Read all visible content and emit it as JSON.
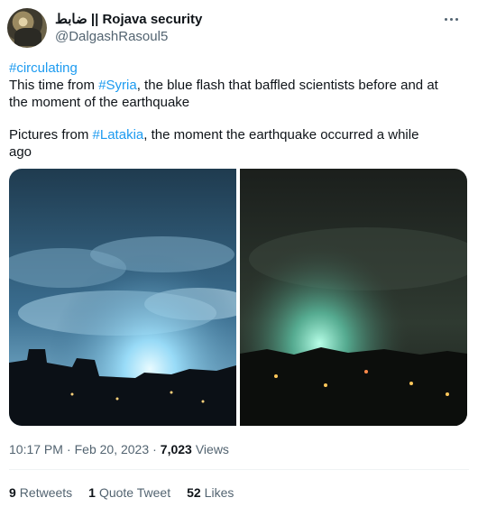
{
  "author": {
    "display_name": "ضابط || Rojava security",
    "handle": "@DalgashRasoul5"
  },
  "tweet": {
    "line1_hashtag": "#circulating",
    "line2_pre": "This time from ",
    "line2_hashtag": "#Syria",
    "line2_post": ", the blue flash that baffled scientists before and at",
    "line3": "the moment of the earthquake",
    "line4_pre": "Pictures from ",
    "line4_hashtag": "#Latakia",
    "line4_post": ", the moment the earthquake occurred a while",
    "line5": "ago"
  },
  "meta": {
    "time": "10:17 PM",
    "sep1": "·",
    "date": "Feb 20, 2023",
    "sep2": "·",
    "views_count": "7,023",
    "views_label": "Views"
  },
  "stats": {
    "retweets_count": "9",
    "retweets_label": "Retweets",
    "quotes_count": "1",
    "quotes_label": "Quote Tweet",
    "likes_count": "52",
    "likes_label": "Likes"
  }
}
